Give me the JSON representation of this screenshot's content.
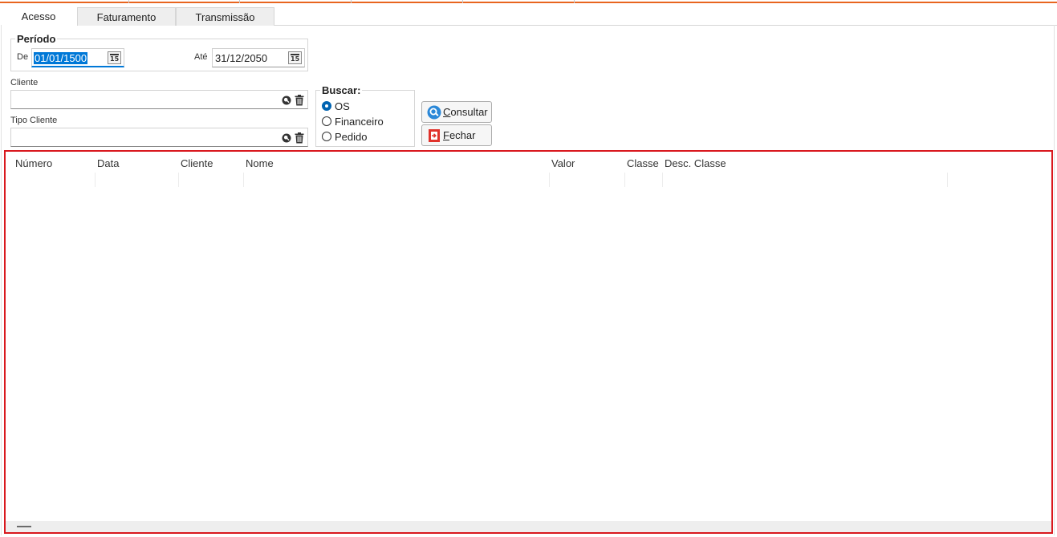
{
  "tabs": [
    {
      "label": "Acesso",
      "active": true
    },
    {
      "label": "Faturamento",
      "active": false
    },
    {
      "label": "Transmissão",
      "active": false
    }
  ],
  "periodo": {
    "title": "Período",
    "de_label": "De",
    "de_value": "01/01/1500",
    "ate_label": "Até",
    "ate_value": "31/12/2050",
    "calendar_num": "15"
  },
  "cliente": {
    "label": "Cliente",
    "value": ""
  },
  "tipo_cliente": {
    "label": "Tipo Cliente",
    "value": ""
  },
  "buscar": {
    "title": "Buscar:",
    "options": [
      {
        "label": "OS",
        "checked": true
      },
      {
        "label": "Financeiro",
        "checked": false
      },
      {
        "label": "Pedido",
        "checked": false
      }
    ]
  },
  "buttons": {
    "consultar": {
      "hotkey": "C",
      "rest": "onsultar"
    },
    "fechar": {
      "hotkey": "F",
      "rest": "echar"
    }
  },
  "grid": {
    "columns": [
      "Número",
      "Data",
      "Cliente",
      "Nome",
      "Valor",
      "Classe",
      "Desc. Classe"
    ]
  },
  "colors": {
    "accent_orange": "#e8651f",
    "selection_blue": "#0078d7",
    "grid_border_red": "#d9181e",
    "search_icon_blue": "#2b88d8",
    "close_icon_red": "#e0322b"
  }
}
